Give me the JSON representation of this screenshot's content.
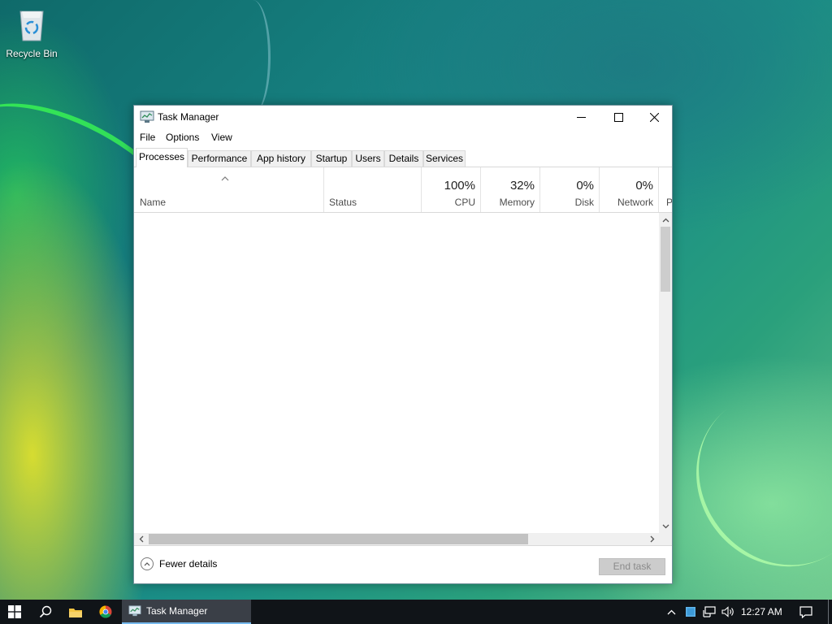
{
  "desktop": {
    "recycle_bin_label": "Recycle Bin"
  },
  "window": {
    "title": "Task Manager",
    "menu": [
      "File",
      "Options",
      "View"
    ],
    "tabs": [
      "Processes",
      "Performance",
      "App history",
      "Startup",
      "Users",
      "Details",
      "Services"
    ],
    "active_tab": "Processes",
    "columns": {
      "name": "Name",
      "status": "Status",
      "cpu": {
        "pct": "100%",
        "label": "CPU"
      },
      "memory": {
        "pct": "32%",
        "label": "Memory"
      },
      "disk": {
        "pct": "0%",
        "label": "Disk"
      },
      "network": {
        "pct": "0%",
        "label": "Network"
      },
      "power_partial": "P"
    },
    "footer": {
      "fewer_details": "Fewer details",
      "end_task": "End task",
      "end_task_enabled": false
    }
  },
  "taskbar": {
    "running_app": "Task Manager",
    "clock": "12:27 AM",
    "accent_color": "#76b9ed"
  }
}
